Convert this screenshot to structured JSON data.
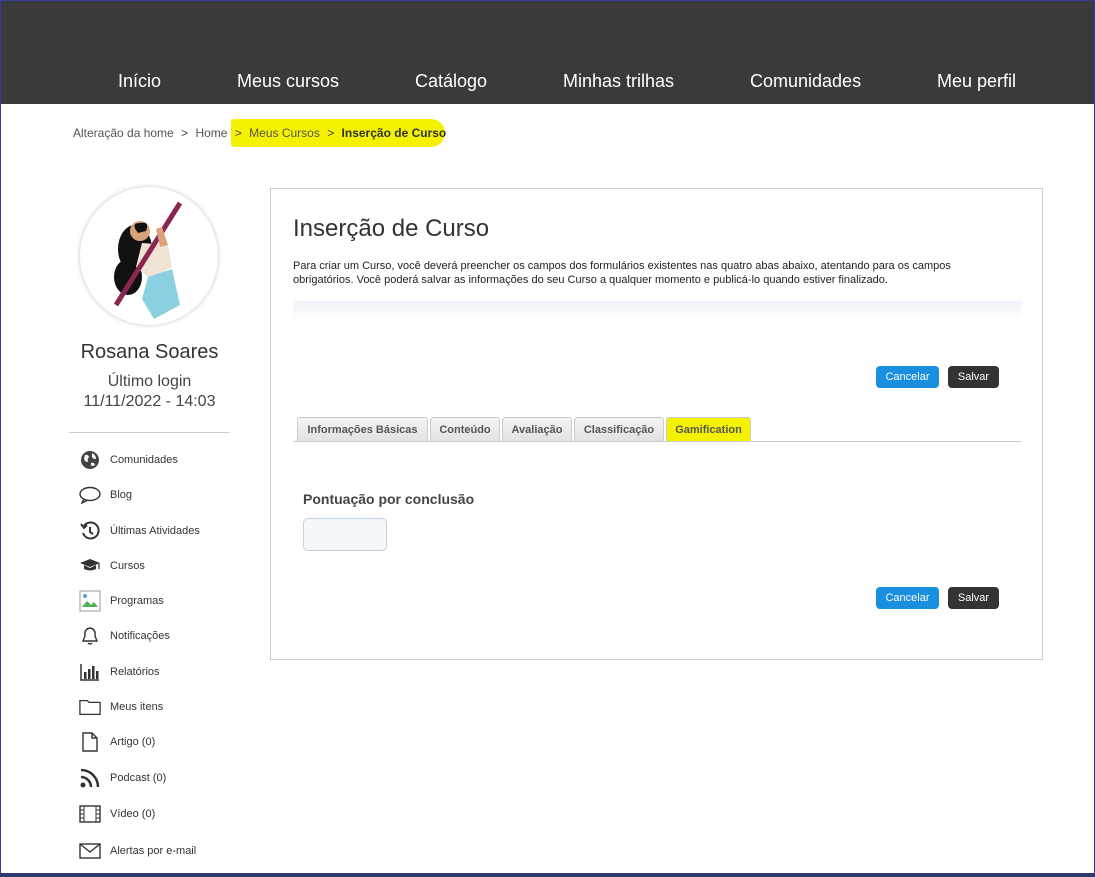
{
  "nav": {
    "items": [
      "Início",
      "Meus cursos",
      "Catálogo",
      "Minhas trilhas",
      "Comunidades",
      "Meu perfil"
    ]
  },
  "breadcrumb": {
    "items": [
      "Alteração da home",
      "Home",
      "Meus Cursos"
    ],
    "separator": ">",
    "current": "Inserção de Curso"
  },
  "profile": {
    "name": "Rosana Soares",
    "last_login_label": "Último login",
    "last_login_value": "11/11/2022 - 14:03"
  },
  "sidebar": {
    "items": [
      {
        "label": "Comunidades",
        "icon": "globe-icon"
      },
      {
        "label": "Blog",
        "icon": "speech-bubble-icon"
      },
      {
        "label": "Últimas Atividades",
        "icon": "history-icon"
      },
      {
        "label": "Cursos",
        "icon": "graduation-cap-icon"
      },
      {
        "label": "Programas",
        "icon": "broken-image-icon"
      },
      {
        "label": "Notificações",
        "icon": "bell-icon"
      },
      {
        "label": "Relatórios",
        "icon": "bar-chart-icon"
      },
      {
        "label": "Meus itens",
        "icon": "folder-icon"
      },
      {
        "label": "Artigo (0)",
        "icon": "document-icon"
      },
      {
        "label": "Podcast (0)",
        "icon": "rss-icon"
      },
      {
        "label": "Vídeo (0)",
        "icon": "film-icon"
      },
      {
        "label": "Alertas por e-mail",
        "icon": "envelope-icon"
      }
    ]
  },
  "main": {
    "title": "Inserção de Curso",
    "description": "Para criar um Curso, você deverá preencher os campos dos formulários existentes nas quatro abas abaixo, atentando para os campos obrigatórios. Você poderá salvar as informações do seu Curso a qualquer momento e publicá-lo quando estiver finalizado.",
    "cancel_label": "Cancelar",
    "save_label": "Salvar",
    "tabs": [
      "Informações Básicas",
      "Conteúdo",
      "Avaliação",
      "Classificação",
      "Gamification"
    ],
    "active_tab": "Gamification",
    "field_label": "Pontuação por conclusão",
    "field_value": ""
  },
  "colors": {
    "topbar": "#3a3a3a",
    "highlight": "#f4f200",
    "cancel": "#1a8fe0",
    "save": "#333333"
  }
}
